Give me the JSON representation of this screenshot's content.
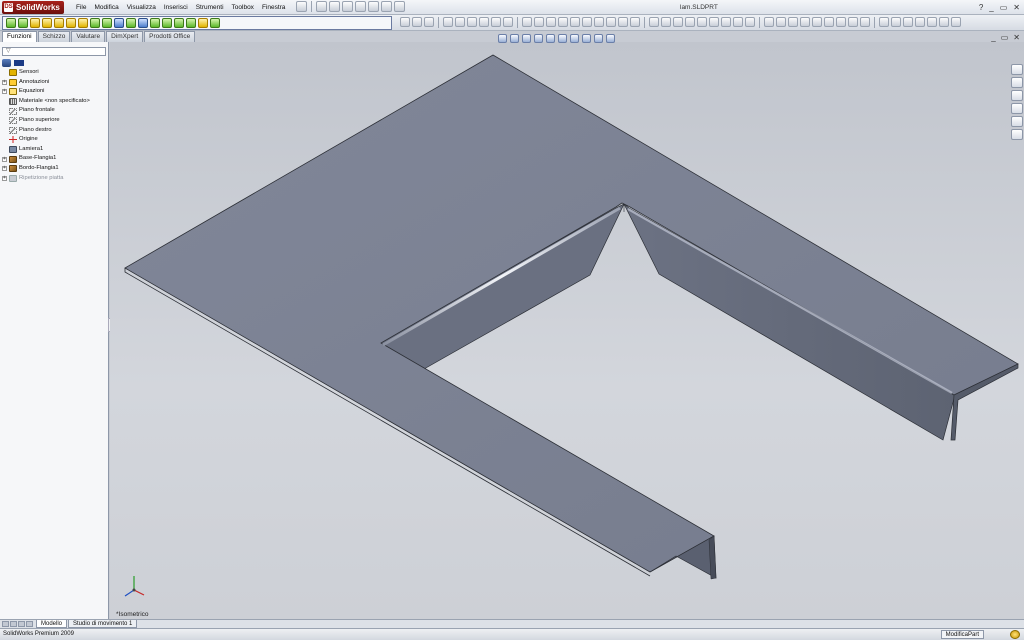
{
  "app": {
    "name": "SolidWorks",
    "logo_mark": "DS",
    "title": "lam.SLDPRT",
    "help": "?",
    "minimize": "_",
    "restore": "▭",
    "close": "✕",
    "viewport_min": "_",
    "viewport_restore": "▭",
    "viewport_close": "✕"
  },
  "menu": [
    "File",
    "Modifica",
    "Visualizza",
    "Inserisci",
    "Strumenti",
    "Toolbox",
    "Finestra"
  ],
  "tabs": [
    {
      "label": "Funzioni",
      "active": true
    },
    {
      "label": "Schizzo",
      "active": false
    },
    {
      "label": "Valutare",
      "active": false
    },
    {
      "label": "DimXpert",
      "active": false
    },
    {
      "label": "Prodotti Office",
      "active": false
    }
  ],
  "feature_manager": {
    "filter_placeholder": "",
    "items": [
      {
        "label": "Sensori",
        "icon": "sensors-icon",
        "expandable": false,
        "dim": false
      },
      {
        "label": "Annotazioni",
        "icon": "annotations-icon",
        "expandable": true,
        "dim": false
      },
      {
        "label": "Equazioni",
        "icon": "equations-icon",
        "expandable": true,
        "dim": false
      },
      {
        "label": "Materiale <non specificato>",
        "icon": "material-icon",
        "expandable": false,
        "dim": false
      },
      {
        "label": "Piano frontale",
        "icon": "plane-icon",
        "expandable": false,
        "dim": false
      },
      {
        "label": "Piano superiore",
        "icon": "plane-icon",
        "expandable": false,
        "dim": false
      },
      {
        "label": "Piano destro",
        "icon": "plane-icon",
        "expandable": false,
        "dim": false
      },
      {
        "label": "Origine",
        "icon": "origin-icon",
        "expandable": false,
        "dim": false
      },
      {
        "label": "Lamiera1",
        "icon": "sheet-metal-icon",
        "expandable": false,
        "dim": false
      },
      {
        "label": "Base-Flangia1",
        "icon": "base-flange-icon",
        "expandable": true,
        "dim": false
      },
      {
        "label": "Bordo-Flangia1",
        "icon": "edge-flange-icon",
        "expandable": true,
        "dim": false
      },
      {
        "label": "Ripetizione piatta",
        "icon": "flat-pattern-icon",
        "expandable": true,
        "dim": true
      }
    ]
  },
  "viewport": {
    "view_label": "*Isometrico"
  },
  "bottom_tabs": [
    {
      "label": "Modello",
      "active": true
    },
    {
      "label": "Studio di movimento 1",
      "active": false
    }
  ],
  "status": {
    "left": "SolidWorks Premium 2009",
    "mode": "ModificaPart"
  },
  "colors": {
    "accent_red": "#a8221b",
    "viewport_bg": "#c7cbd3",
    "model_face": "#7d8394",
    "model_edge": "#2c2f36"
  }
}
